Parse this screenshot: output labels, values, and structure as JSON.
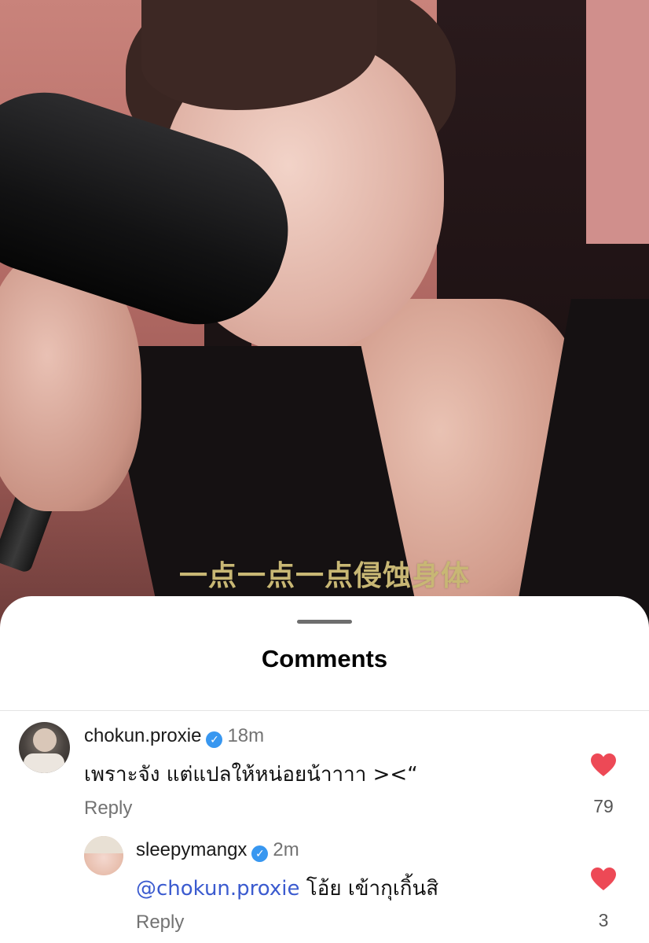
{
  "video": {
    "caption": "一点一点一点侵蚀身体"
  },
  "sheet": {
    "title": "Comments"
  },
  "comments": [
    {
      "username": "chokun.proxie",
      "verified": true,
      "time": "18m",
      "text": "เพราะจัง แต่แปลให้หน่อยน้าาาา ><“",
      "reply_label": "Reply",
      "likes": "79",
      "liked": true
    },
    {
      "username": "sleepymangx",
      "verified": true,
      "time": "2m",
      "mention": "@chokun.proxie",
      "text": "โอ้ย เข้ากุเกิ้นสิ",
      "reply_label": "Reply",
      "likes": "3",
      "liked": true
    }
  ],
  "icons": {
    "verified": "check-badge-icon",
    "like": "heart-icon"
  },
  "colors": {
    "heart": "#ed4956",
    "verified": "#3897f0",
    "mention": "#3b5bcf"
  }
}
